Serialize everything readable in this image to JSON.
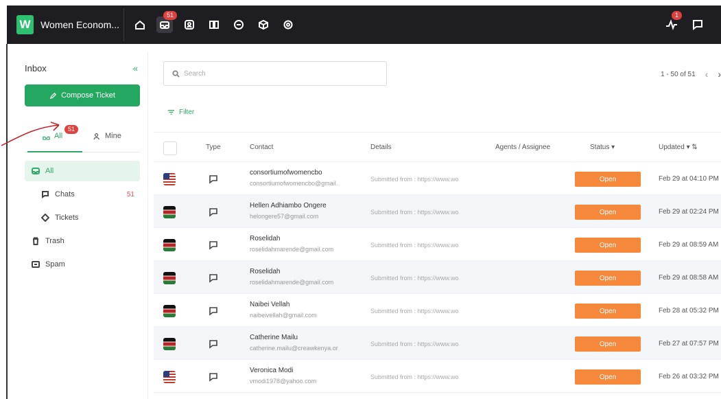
{
  "app": {
    "logo_letter": "W",
    "name": "Women Econom..."
  },
  "nav": {
    "icons": [
      "home-icon",
      "inbox-icon",
      "contacts-icon",
      "book-icon",
      "chat-icon",
      "box-icon",
      "settings-icon"
    ],
    "inbox_badge": "51",
    "activity_badge": "1"
  },
  "sidebar": {
    "title": "Inbox",
    "collapse": "«",
    "compose_label": "Compose Ticket",
    "tabs": {
      "all_label": "All",
      "all_badge": "51",
      "mine_label": "Mine"
    },
    "items": [
      {
        "label": "All"
      },
      {
        "label": "Chats",
        "count": "51"
      },
      {
        "label": "Tickets"
      },
      {
        "label": "Trash"
      },
      {
        "label": "Spam"
      }
    ]
  },
  "main": {
    "search_placeholder": "Search",
    "pager_text": "1 - 50 of 51",
    "prev": "‹",
    "next": "›",
    "filter_label": "Filter",
    "columns": {
      "type": "Type",
      "contact": "Contact",
      "details": "Details",
      "agents": "Agents / Assignee",
      "status": "Status",
      "updated": "Updated"
    },
    "rows": [
      {
        "flag": "us",
        "name": "consortiumofwomencbo",
        "email": "consortiumofwomencbo@gmail.",
        "details": "Submitted from : https://www.wo",
        "status": "Open",
        "updated": "Feb 29 at 04:10 PM"
      },
      {
        "flag": "ke",
        "name": "Hellen Adhiambo Ongere",
        "email": "helongere57@gmail.com",
        "details": "Submitted from : https://www.wo",
        "status": "Open",
        "updated": "Feb 29 at 02:24 PM"
      },
      {
        "flag": "ke",
        "name": "Roselidah",
        "email": "roselidahmarende@gmail.com",
        "details": "Submitted from : https://www.wo",
        "status": "Open",
        "updated": "Feb 29 at 08:59 AM"
      },
      {
        "flag": "ke",
        "name": "Roselidah",
        "email": "roselidahmarende@gmail.com",
        "details": "Submitted from : https://www.wo",
        "status": "Open",
        "updated": "Feb 29 at 08:58 AM"
      },
      {
        "flag": "ke",
        "name": "Naibei Vellah",
        "email": "naibeivellah@gmail.com",
        "details": "Submitted from : https://www.wo",
        "status": "Open",
        "updated": "Feb 28 at 05:32 PM"
      },
      {
        "flag": "ke",
        "name": "Catherine Mailu",
        "email": "catherine.mailu@creawkenya.or",
        "details": "Submitted from : https://www.wo",
        "status": "Open",
        "updated": "Feb 27 at 07:57 PM"
      },
      {
        "flag": "us",
        "name": "Veronica Modi",
        "email": "vmodi1978@yahoo.com",
        "details": "Submitted from : https://www.wo",
        "status": "Open",
        "updated": "Feb 26 at 03:32 PM"
      }
    ]
  },
  "colors": {
    "accent": "#24a85f",
    "status_open": "#f5883a",
    "topbar": "#1e1e22",
    "badge": "#e0413f"
  }
}
